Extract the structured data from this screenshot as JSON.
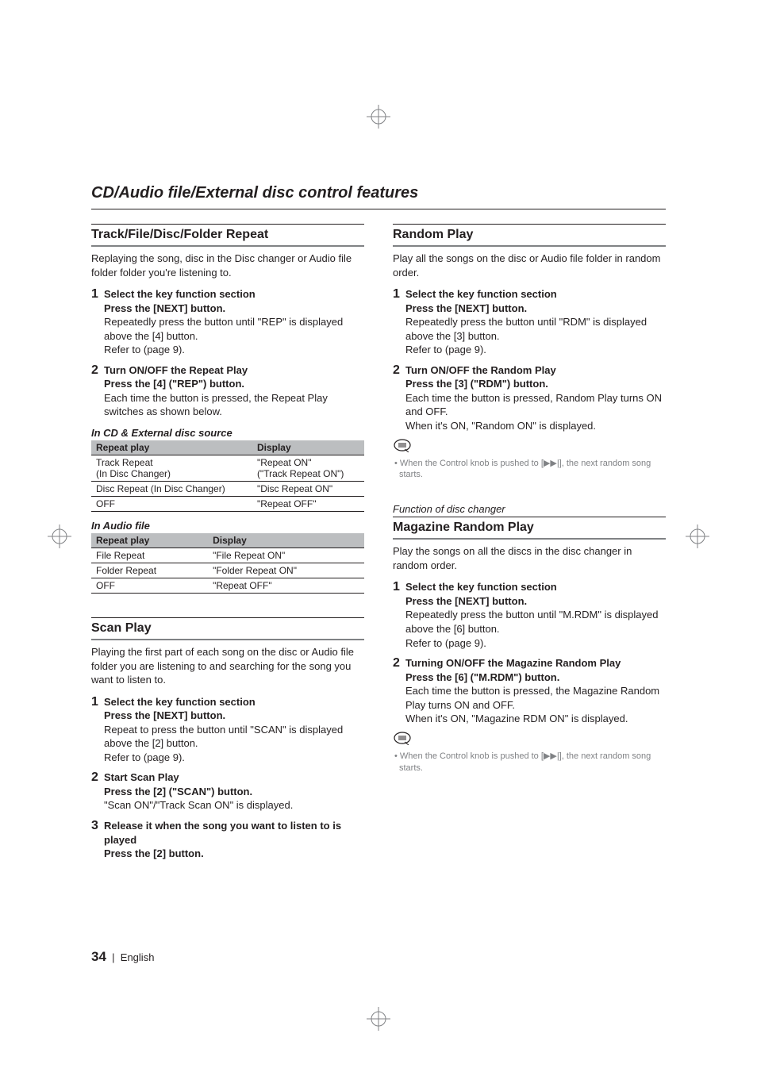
{
  "section_title": "CD/Audio file/External disc control features",
  "left": {
    "feat1": {
      "title": "Track/File/Disc/Folder Repeat",
      "intro": "Replaying the song, disc in the Disc changer or Audio file folder folder you're listening to.",
      "step1_head1": "Select the key function section",
      "step1_head2": "Press the [NEXT] button.",
      "step1_desc": "Repeatedly press the button until \"REP\" is displayed above the [4] button.\nRefer to <Notes on Multi-function Key System> (page 9).",
      "step2_head1": "Turn ON/OFF the Repeat Play",
      "step2_head2": "Press the [4] (\"REP\") button.",
      "step2_desc": "Each time the button is pressed, the Repeat Play switches as shown below.",
      "sub1": "In CD & External disc source",
      "table1_h1": "Repeat play",
      "table1_h2": "Display",
      "table1_r1c1": "Track Repeat\n(In Disc Changer)",
      "table1_r1c2": "\"Repeat ON\"\n(\"Track Repeat ON\")",
      "table1_r2c1": "Disc Repeat (In Disc Changer)",
      "table1_r2c2": "\"Disc Repeat ON\"",
      "table1_r3c1": "OFF",
      "table1_r3c2": "\"Repeat OFF\"",
      "sub2": "In Audio file",
      "table2_h1": "Repeat play",
      "table2_h2": "Display",
      "table2_r1c1": "File Repeat",
      "table2_r1c2": "\"File Repeat ON\"",
      "table2_r2c1": "Folder Repeat",
      "table2_r2c2": "\"Folder Repeat ON\"",
      "table2_r3c1": "OFF",
      "table2_r3c2": "\"Repeat OFF\""
    },
    "feat2": {
      "title": "Scan Play",
      "intro": "Playing the first part of each song on the disc or Audio file folder you are listening to and searching for the song you want to listen to.",
      "step1_head1": "Select the key function section",
      "step1_head2": "Press the [NEXT] button.",
      "step1_desc": "Repeat to press the button until \"SCAN\" is displayed above the [2] button.\nRefer to <Notes on Multi-function Key System> (page 9).",
      "step2_head1": "Start Scan Play",
      "step2_head2": "Press the [2] (\"SCAN\") button.",
      "step2_desc": "\"Scan ON\"/\"Track Scan ON\" is displayed.",
      "step3_head1": "Release it when the song you want to listen to is played",
      "step3_head2": "Press the [2] button."
    }
  },
  "right": {
    "feat1": {
      "title": "Random Play",
      "intro": "Play all the songs on the disc or Audio file folder in random order.",
      "step1_head1": "Select the key function section",
      "step1_head2": "Press the [NEXT] button.",
      "step1_desc": "Repeatedly press the button until \"RDM\" is displayed above the [3] button.\nRefer to <Notes on Multi-function Key System> (page 9).",
      "step2_head1": "Turn ON/OFF the Random Play",
      "step2_head2": "Press the [3] (\"RDM\") button.",
      "step2_desc": "Each time the button is pressed, Random Play turns ON and OFF.\nWhen it's ON, \"Random ON\" is displayed.",
      "note": "When the Control knob is pushed to [▶▶|], the next random song starts."
    },
    "feat2": {
      "func_note": "Function of disc changer",
      "title": "Magazine Random Play",
      "intro": "Play the songs on all the discs in the disc changer in random order.",
      "step1_head1": "Select the key function section",
      "step1_head2": "Press the [NEXT] button.",
      "step1_desc": "Repeatedly press the button until \"M.RDM\" is displayed above the [6] button.\nRefer to <Notes on Multi-function Key System> (page 9).",
      "step2_head1": "Turning ON/OFF the Magazine Random Play",
      "step2_head2": "Press the [6] (\"M.RDM\") button.",
      "step2_desc": "Each time the button is pressed, the Magazine Random Play turns ON and OFF.\nWhen it's ON, \"Magazine RDM ON\" is displayed.",
      "note": "When the Control knob is pushed to [▶▶|], the next random song starts."
    }
  },
  "footer": {
    "page_num": "34",
    "sep": "|",
    "lang": "English"
  }
}
